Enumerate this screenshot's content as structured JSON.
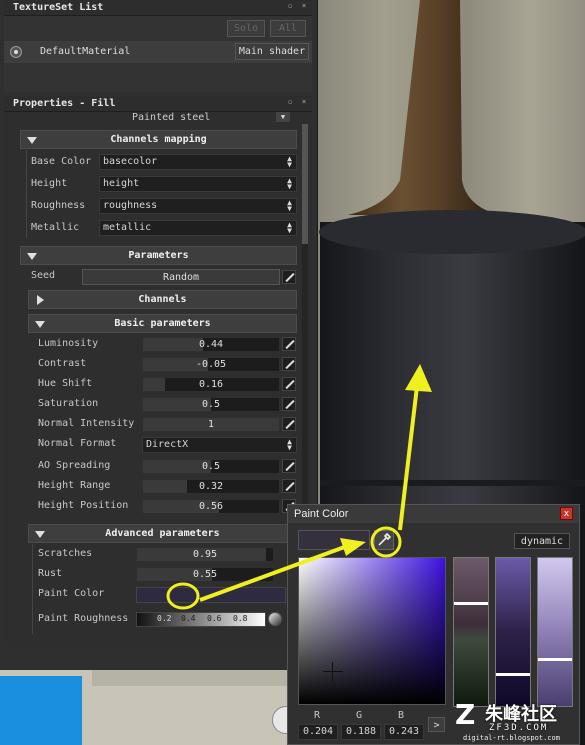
{
  "texture_set_list": {
    "title": "TextureSet List",
    "solo": "Solo",
    "all": "All",
    "material": "DefaultMaterial",
    "shader": "Main shader"
  },
  "properties": {
    "title": "Properties - Fill",
    "material_preset": "Painted steel"
  },
  "channels_mapping": {
    "title": "Channels mapping",
    "rows": [
      {
        "label": "Base Color",
        "value": "basecolor"
      },
      {
        "label": "Height",
        "value": "height"
      },
      {
        "label": "Roughness",
        "value": "roughness"
      },
      {
        "label": "Metallic",
        "value": "metallic"
      }
    ]
  },
  "parameters": {
    "title": "Parameters",
    "seed_label": "Seed",
    "seed_value": "Random"
  },
  "channels": {
    "title": "Channels"
  },
  "basic": {
    "title": "Basic parameters",
    "luminosity": {
      "label": "Luminosity",
      "value": "0.44",
      "fill": 0.44
    },
    "contrast": {
      "label": "Contrast",
      "value": "-0.05",
      "fill": 0.48
    },
    "hue_shift": {
      "label": "Hue Shift",
      "value": "0.16",
      "fill": 0.16
    },
    "saturation": {
      "label": "Saturation",
      "value": "0.5",
      "fill": 0.5
    },
    "normal_intensity": {
      "label": "Normal Intensity",
      "value": "1",
      "fill": 1.0
    },
    "normal_format": {
      "label": "Normal Format",
      "value": "DirectX"
    },
    "ao_spreading": {
      "label": "AO Spreading",
      "value": "0.5",
      "fill": 0.5
    },
    "height_range": {
      "label": "Height Range",
      "value": "0.32",
      "fill": 0.32
    },
    "height_position": {
      "label": "Height Position",
      "value": "0.56",
      "fill": 0.56
    }
  },
  "advanced": {
    "title": "Advanced parameters",
    "scratches": {
      "label": "Scratches",
      "value": "0.95",
      "fill": 0.95
    },
    "rust": {
      "label": "Rust",
      "value": "0.55",
      "fill": 0.55
    },
    "paint_color": {
      "label": "Paint Color",
      "color": "#2e2b40"
    },
    "paint_roughness": {
      "label": "Paint Roughness",
      "ticks": [
        "0.2",
        "0.4",
        "0.6",
        "0.8"
      ]
    }
  },
  "paint_dialog": {
    "title": "Paint Color",
    "close": "x",
    "mode": "dynamic",
    "r_label": "R",
    "g_label": "G",
    "b_label": "B",
    "r": "0.204",
    "g": "0.188",
    "b": "0.243",
    "next": ">",
    "swatch": "#34303e",
    "hue": "#3d12e0"
  },
  "watermark": {
    "logo": "朱峰社区",
    "site": "ZF3D.COM",
    "url": "digital-rt.blogspot.com"
  },
  "colors": {
    "annotation": "#f0f020"
  }
}
